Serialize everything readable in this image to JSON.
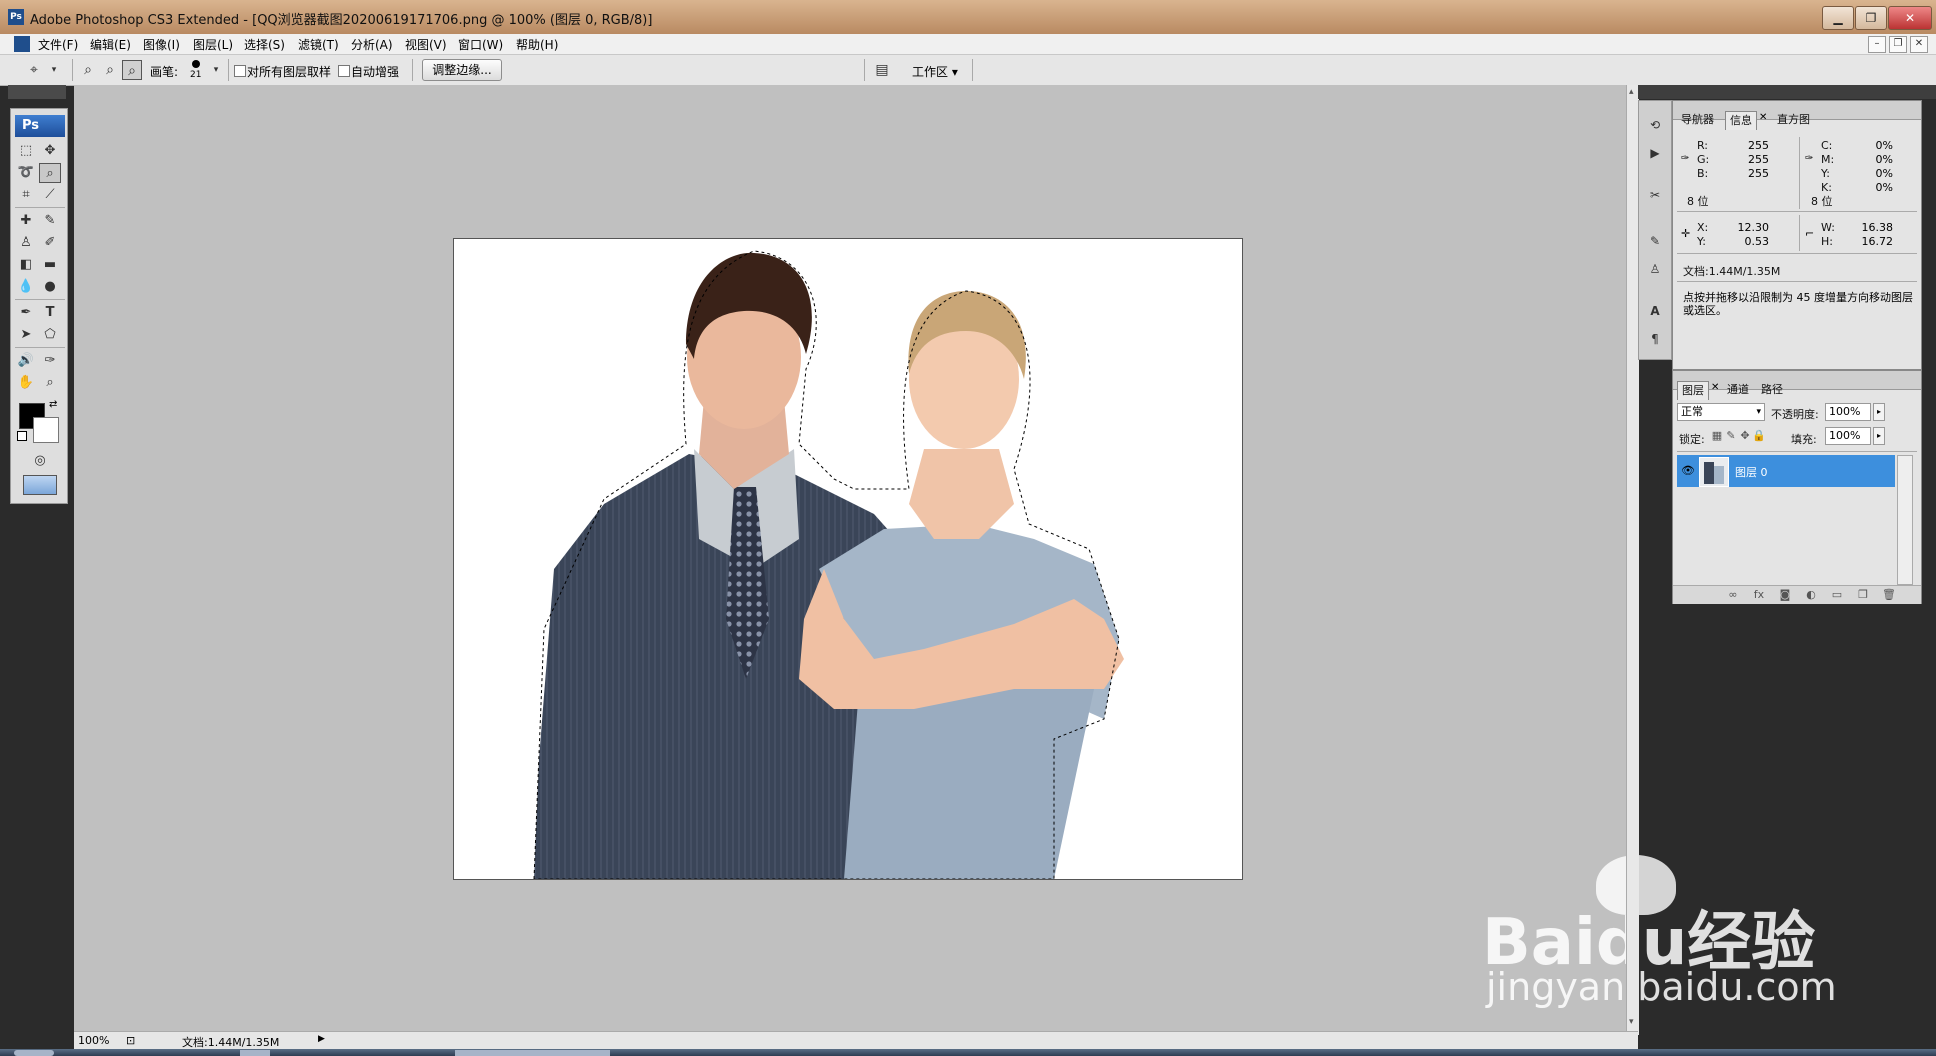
{
  "titlebar": {
    "app_badge": "Ps",
    "title": "Adobe Photoshop CS3 Extended - [QQ浏览器截图20200619171706.png @ 100% (图层 0, RGB/8)]",
    "min": "▁",
    "max": "❐",
    "close": "✕"
  },
  "menubar": {
    "items": [
      "文件(F)",
      "编辑(E)",
      "图像(I)",
      "图层(L)",
      "选择(S)",
      "滤镜(T)",
      "分析(A)",
      "视图(V)",
      "窗口(W)",
      "帮助(H)"
    ],
    "doc_min": "–",
    "doc_restore": "❐",
    "doc_close": "✕"
  },
  "options": {
    "brush_label": "画笔:",
    "brush_size": "21",
    "sample_all_label": "对所有图层取样",
    "auto_enhance_label": "自动增强",
    "refine_edge_label": "调整边缘...",
    "workspace_label": "工作区 ▾"
  },
  "toolbox": {
    "logo": "Ps"
  },
  "status": {
    "zoom": "100%",
    "doc_size": "文档:1.44M/1.35M"
  },
  "info_panel": {
    "tabs": [
      "导航器",
      "信息",
      "直方图"
    ],
    "rgb": {
      "r_label": "R:",
      "r": "255",
      "g_label": "G:",
      "g": "255",
      "b_label": "B:",
      "b": "255"
    },
    "cmyk": {
      "c_label": "C:",
      "c": "0%",
      "m_label": "M:",
      "m": "0%",
      "y_label": "Y:",
      "y": "0%",
      "k_label": "K:",
      "k": "0%"
    },
    "bit_left": "8 位",
    "bit_right": "8 位",
    "xy": {
      "x_label": "X:",
      "x": "12.30",
      "y_label": "Y:",
      "y": "0.53"
    },
    "wh": {
      "w_label": "W:",
      "w": "16.38",
      "h_label": "H:",
      "h": "16.72"
    },
    "doc_size": "文档:1.44M/1.35M",
    "hint": "点按并拖移以沿限制为 45 度增量方向移动图层或选区。"
  },
  "layers_panel": {
    "tabs": [
      "图层",
      "通道",
      "路径"
    ],
    "blend_mode": "正常",
    "opacity_label": "不透明度:",
    "opacity": "100%",
    "lock_label": "锁定:",
    "fill_label": "填充:",
    "fill": "100%",
    "layer_name": "图层 0"
  },
  "watermark": {
    "brand": "Baidu经验",
    "url": "jingyan.baidu.com"
  },
  "colors": {
    "workspace": "#c0c0c0",
    "selection": "#3d8fdd"
  }
}
